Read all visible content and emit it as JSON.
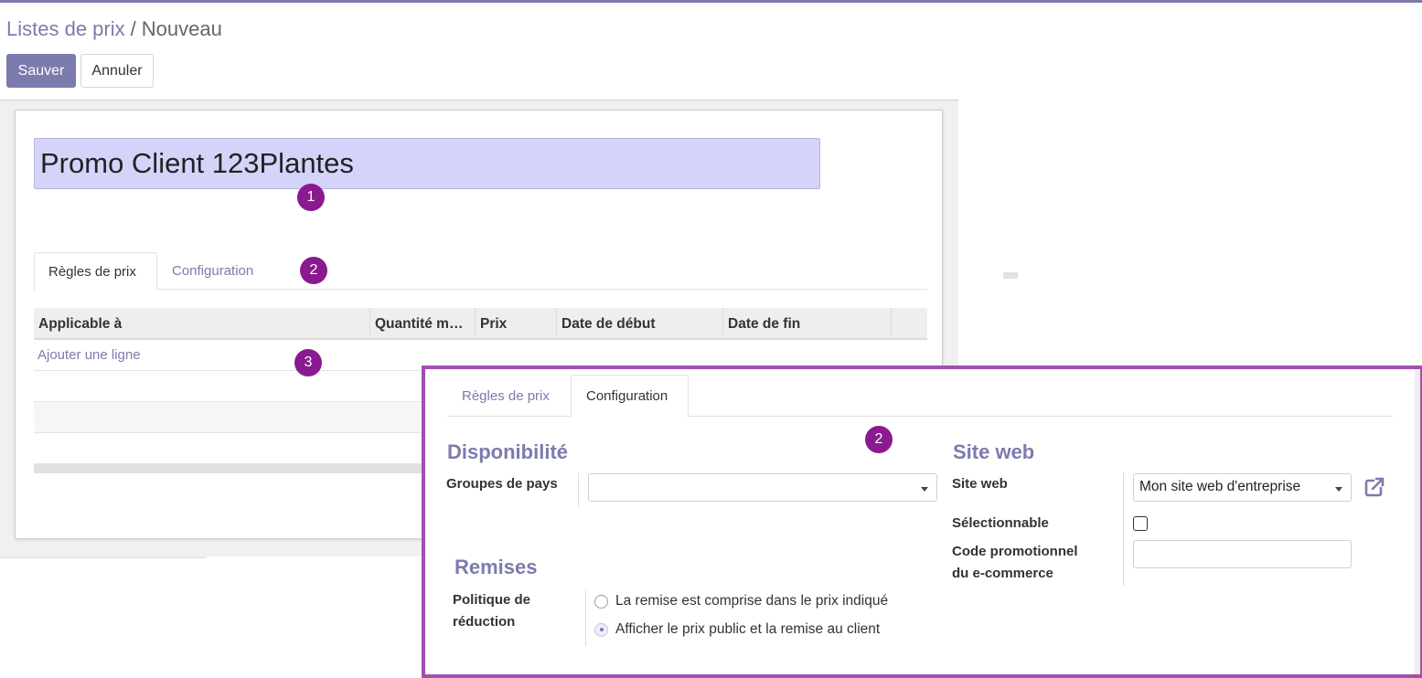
{
  "breadcrumb": {
    "parent": "Listes de prix",
    "separator": "/",
    "current": "Nouveau"
  },
  "toolbar": {
    "save_label": "Sauver",
    "cancel_label": "Annuler"
  },
  "record": {
    "name": "Promo Client 123Plantes"
  },
  "badges": {
    "one": "1",
    "two": "2",
    "three": "3"
  },
  "tabs": [
    {
      "label": "Règles de prix",
      "active": true
    },
    {
      "label": "Configuration",
      "active": false
    }
  ],
  "table": {
    "columns": [
      "Applicable à",
      "Quantité m…",
      "Prix",
      "Date de début",
      "Date de fin"
    ],
    "add_line": "Ajouter une ligne"
  },
  "overlay": {
    "tabs": [
      {
        "label": "Règles de prix",
        "active": false
      },
      {
        "label": "Configuration",
        "active": true
      }
    ],
    "availability": {
      "title": "Disponibilité",
      "country_groups_label": "Groupes de pays",
      "country_groups_value": ""
    },
    "discounts": {
      "title": "Remises",
      "policy_label_line1": "Politique de",
      "policy_label_line2": "réduction",
      "options": [
        {
          "label": "La remise est comprise dans le prix indiqué",
          "checked": false
        },
        {
          "label": "Afficher le prix public et la remise au client",
          "checked": true
        }
      ]
    },
    "website": {
      "title": "Site web",
      "site_label": "Site web",
      "site_value": "Mon site web d'entreprise",
      "selectable_label": "Sélectionnable",
      "selectable_checked": false,
      "promo_label_line1": "Code promotionnel",
      "promo_label_line2": "du e-commerce",
      "promo_value": ""
    }
  },
  "colors": {
    "accent": "#7c7bad",
    "badge": "#8a1a8f",
    "highlight_border": "#a24fb0",
    "name_field_bg": "#d4d4fb"
  }
}
